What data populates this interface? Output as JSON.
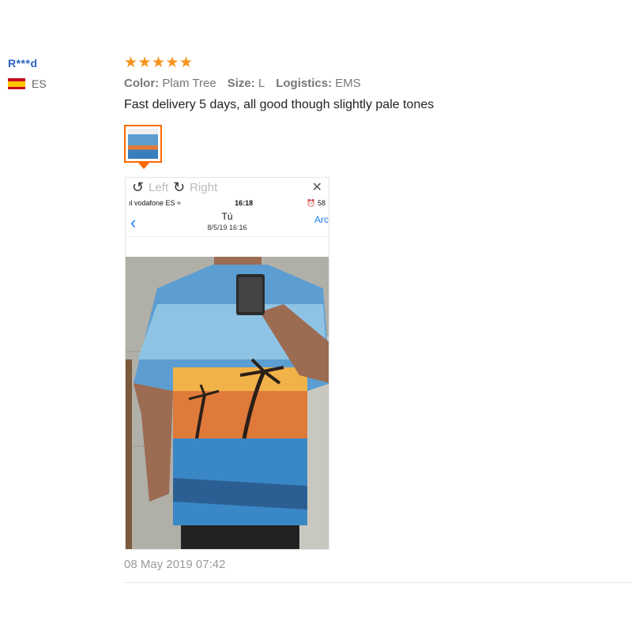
{
  "reviewer": {
    "name": "R***d",
    "country": "ES",
    "flag_icon": "spain-flag-icon"
  },
  "review": {
    "stars": [
      "★",
      "★",
      "★",
      "★",
      "★"
    ],
    "rating": 5,
    "color_label": "Color:",
    "color_value": "Plam Tree",
    "size_label": "Size:",
    "size_value": "L",
    "logistics_label": "Logistics:",
    "logistics_value": "EMS",
    "comment": "Fast delivery 5 days, all good though slightly pale tones",
    "date": "08 May 2019 07:42"
  },
  "viewer": {
    "left_label": "Left",
    "right_label": "Right",
    "close_symbol": "✕",
    "rotate_left_symbol": "↺",
    "rotate_right_symbol": "↻",
    "phone": {
      "carrier": "ıl vodafone ES ≈",
      "time": "16:18",
      "battery": "⏰ 58",
      "back": "‹",
      "title": "Tú",
      "subtitle": "8/5/19 16:16",
      "action": "Arc"
    }
  },
  "colors": {
    "accent": "#ff6a00",
    "star": "#f7931e",
    "name": "#2a64c5",
    "ios_blue": "#1a7cf0"
  }
}
